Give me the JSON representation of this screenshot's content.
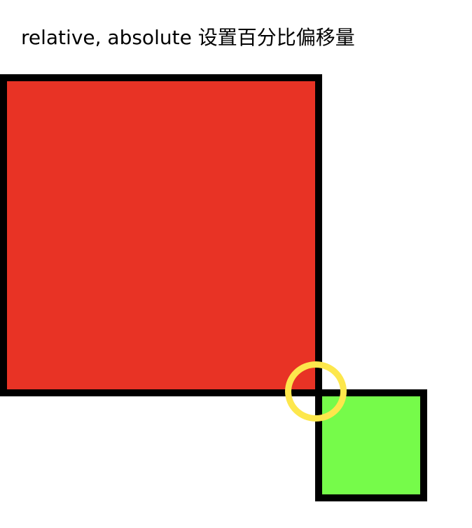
{
  "page": {
    "title": "relative, absolute 设置百分比偏移量"
  },
  "colors": {
    "background": "#ffffff",
    "border": "#000000",
    "red_box_fill": "#e83325",
    "green_box_fill": "#76fb4a",
    "highlight_ring": "#fde74c"
  }
}
